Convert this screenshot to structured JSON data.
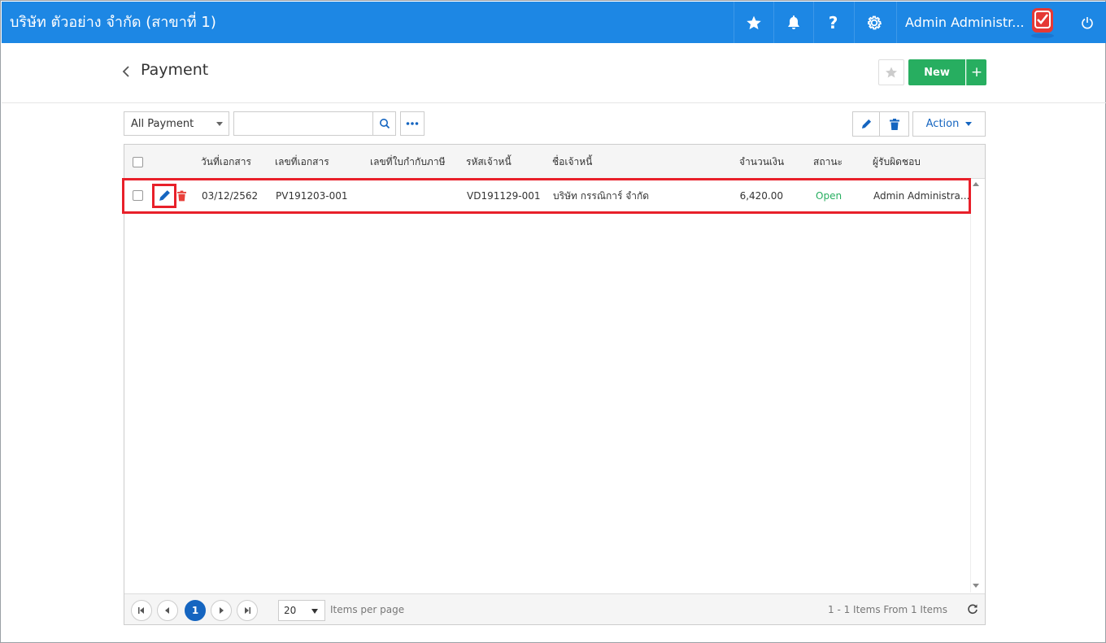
{
  "header": {
    "company": "บริษัท ตัวอย่าง จำกัด (สาขาที่ 1)",
    "user": "Admin Administr...",
    "help_label": "?"
  },
  "page": {
    "title": "Payment",
    "new_label": "New",
    "plus_label": "+"
  },
  "toolbar": {
    "filter_value": "All Payment",
    "search_placeholder": "",
    "action_label": "Action"
  },
  "grid": {
    "columns": [
      "วันที่เอกสาร",
      "เลขที่เอกสาร",
      "เลขที่ใบกำกับภาษี",
      "รหัสเจ้าหนี้",
      "ชื่อเจ้าหนี้",
      "จำนวนเงิน",
      "สถานะ",
      "ผู้รับผิดชอบ"
    ],
    "rows": [
      {
        "doc_date": "03/12/2562",
        "doc_no": "PV191203-001",
        "tax_invoice": "",
        "vendor_code": "VD191129-001",
        "vendor_name": "บริษัท กรรณิการ์ จำกัด",
        "amount": "6,420.00",
        "status": "Open",
        "owner": "Admin Administra..."
      }
    ]
  },
  "pager": {
    "current_page": "1",
    "page_size": "20",
    "items_per_page_label": "Items per page",
    "range_label": "1 - 1 Items From 1 Items"
  },
  "colors": {
    "topbar": "#1d87e4",
    "primary_green": "#27ae60",
    "accent_blue": "#1565c0",
    "status_open": "#27ae60",
    "delete_red": "#e8403a",
    "highlight_red": "#e8202a"
  }
}
